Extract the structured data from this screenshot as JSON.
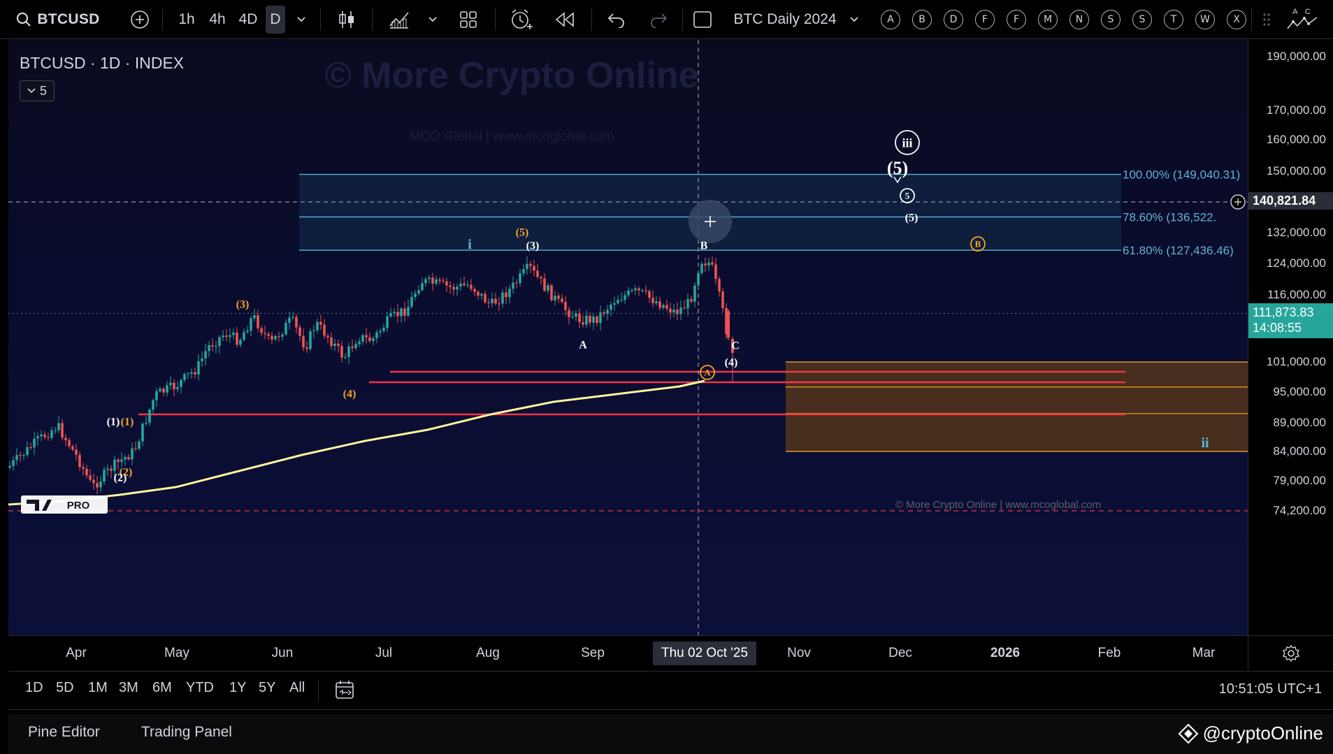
{
  "toolbar": {
    "symbol": "BTCUSD",
    "timeframes": [
      "1h",
      "4h",
      "4D",
      "D"
    ],
    "active_timeframe": "D",
    "layout_name": "BTC Daily 2024",
    "quick_letters": [
      "A",
      "B",
      "D",
      "F",
      "F",
      "M",
      "N",
      "S",
      "S",
      "T",
      "W",
      "X"
    ],
    "right_letters": "A C"
  },
  "chart": {
    "legend_title": "BTCUSD · 1D · INDEX",
    "legend_count": "5",
    "watermark_title": "© More Crypto Online",
    "watermark_sub": "MCO Global  |  www.mcoglobal.com",
    "copyright": "© More Crypto Online  |  www.mcoglobal.com",
    "tv_badge": "PRO",
    "fib_levels": [
      {
        "label": "100.00% (149,040.31)",
        "price": 149040.31
      },
      {
        "label": "78.60% (136,522.",
        "price": 136522
      },
      {
        "label": "61.80% (127,436.46)",
        "price": 127436.46
      }
    ],
    "wave_labels": [
      {
        "text": "iii",
        "style": "circle-white"
      },
      {
        "text": "(5)",
        "style": "big-white"
      },
      {
        "text": "5",
        "style": "circle-white-small"
      },
      {
        "text": "(5)",
        "style": "white"
      },
      {
        "text": "B",
        "style": "circle-orange"
      },
      {
        "text": "i",
        "style": "blue"
      },
      {
        "text": "(5)",
        "style": "orange"
      },
      {
        "text": "(3)",
        "style": "white"
      },
      {
        "text": "B",
        "style": "white"
      },
      {
        "text": "(3)",
        "style": "orange"
      },
      {
        "text": "A",
        "style": "white"
      },
      {
        "text": "C",
        "style": "white"
      },
      {
        "text": "(4)",
        "style": "white"
      },
      {
        "text": "A",
        "style": "circle-orange"
      },
      {
        "text": "(4)",
        "style": "orange"
      },
      {
        "text": "(1)",
        "style": "white"
      },
      {
        "text": "(1)",
        "style": "orange"
      },
      {
        "text": "(2)",
        "style": "orange"
      },
      {
        "text": "(2)",
        "style": "white"
      },
      {
        "text": "ii",
        "style": "blue"
      }
    ]
  },
  "price_axis": {
    "labels": [
      "190,000.00",
      "170,000.00",
      "160,000.00",
      "150,000.00",
      "132,000.00",
      "124,000.00",
      "116,000.00",
      "101,000.00",
      "95,000.00",
      "89,000.00",
      "84,000.00",
      "79,000.00",
      "74,200.00"
    ],
    "crosshair_price": "140,821.84",
    "last_price": "111,873.83",
    "countdown": "14:08:55"
  },
  "time_axis": {
    "labels": [
      "Apr",
      "May",
      "Jun",
      "Jul",
      "Aug",
      "Sep",
      "Nov",
      "Dec",
      "2026",
      "Feb",
      "Mar"
    ],
    "crosshair_date": "Thu 02 Oct '25"
  },
  "range_bar": {
    "ranges": [
      "1D",
      "5D",
      "1M",
      "3M",
      "6M",
      "YTD",
      "1Y",
      "5Y",
      "All"
    ],
    "clock": "10:51:05 UTC+1"
  },
  "footer": {
    "tabs": [
      "Pine Editor",
      "Trading Panel"
    ],
    "brand": "@cryptoOnline"
  },
  "colors": {
    "fib_line": "#5fb3d6",
    "fib_zone": "#12304d",
    "support_line": "#f23645",
    "target_zone": "#7a4a0e",
    "target_line": "#f5a623",
    "ma_line": "#fff59d",
    "candle_up": "#26a69a",
    "candle_down": "#ef5350",
    "label_orange": "#f5a623",
    "label_blue": "#5fb3d6"
  }
}
